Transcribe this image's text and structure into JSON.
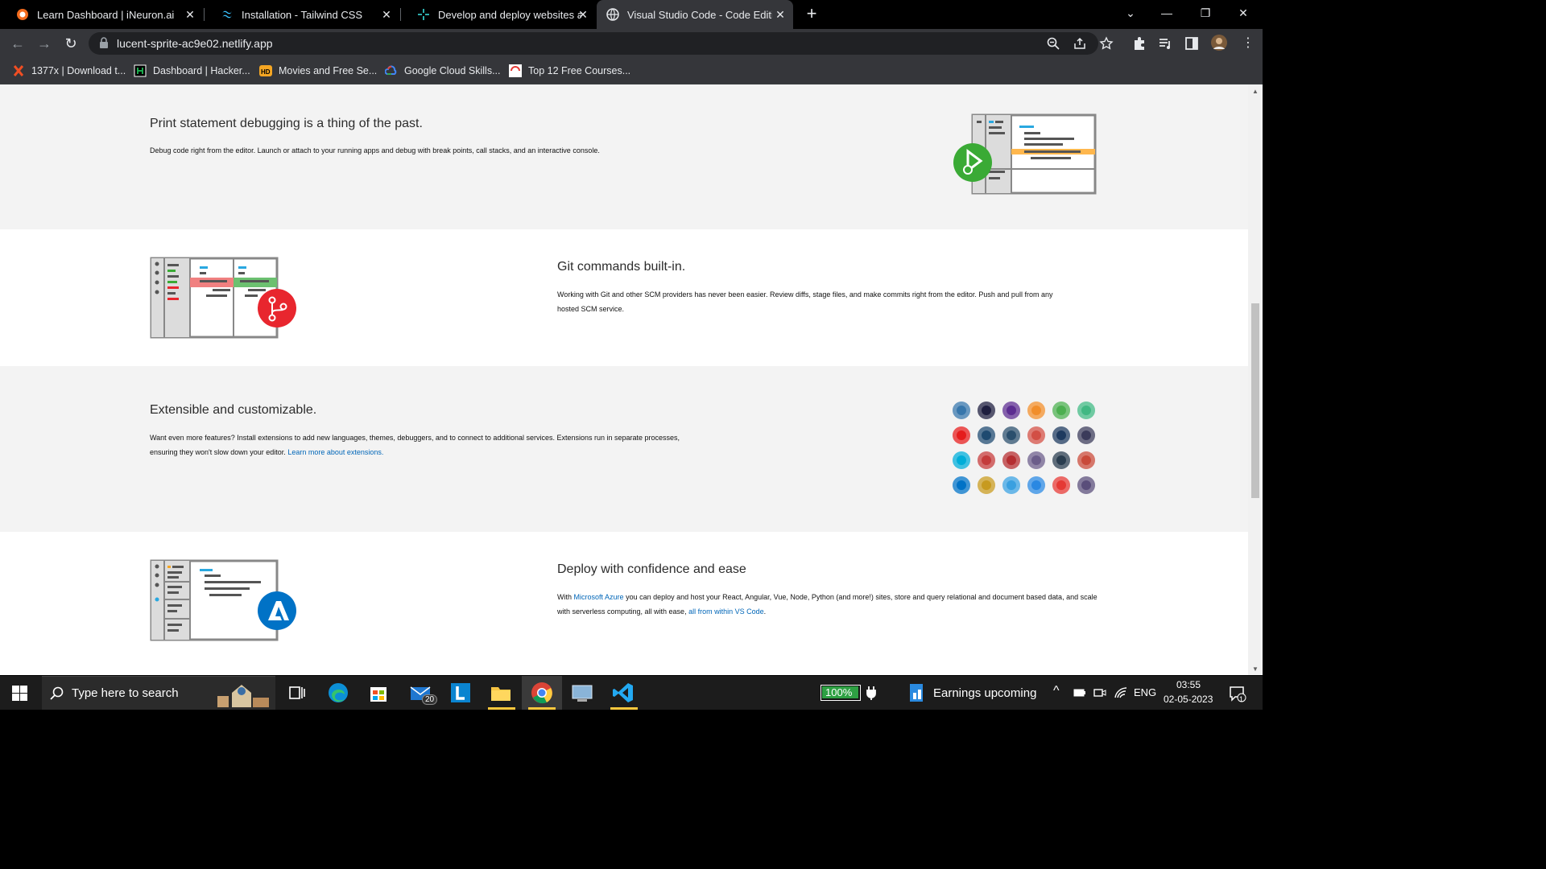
{
  "tabs": [
    {
      "title": "Learn Dashboard | iNeuron.ai",
      "icon": "ineuron-icon"
    },
    {
      "title": "Installation - Tailwind CSS",
      "icon": "tailwind-icon"
    },
    {
      "title": "Develop and deploy websites and",
      "icon": "netlify-icon"
    },
    {
      "title": "Visual Studio Code - Code Editing",
      "icon": "globe-icon"
    }
  ],
  "address_bar": {
    "url": "lucent-sprite-ac9e02.netlify.app"
  },
  "bookmarks": [
    {
      "label": "1377x | Download t...",
      "icon": "x-icon"
    },
    {
      "label": "Dashboard | Hacker...",
      "icon": "hackerrank-icon"
    },
    {
      "label": "Movies and Free Se...",
      "icon": "hd-icon"
    },
    {
      "label": "Google Cloud Skills...",
      "icon": "google-cloud-icon"
    },
    {
      "label": "Top 12 Free Courses...",
      "icon": "courses-icon"
    }
  ],
  "sections": {
    "debug": {
      "title": "Print statement debugging is a thing of the past.",
      "body": "Debug code right from the editor. Launch or attach to your running apps and debug with break points, call stacks, and an interactive console."
    },
    "git": {
      "title": "Git commands built-in.",
      "body": "Working with Git and other SCM providers has never been easier. Review diffs, stage files, and make commits right from the editor. Push and pull from any hosted SCM service."
    },
    "extensible": {
      "title": "Extensible and customizable.",
      "body": "Want even more features? Install extensions to add new languages, themes, debuggers, and to connect to additional services. Extensions run in separate processes, ensuring they won't slow down your editor.",
      "link": "Learn more about extensions."
    },
    "deploy": {
      "title": "Deploy with confidence and ease",
      "body_pre": "With",
      "link1": "Microsoft Azure",
      "body_mid": "you can deploy and host your React, Angular, Vue, Node, Python (and more!) sites, store and query relational and document based data, and scale with serverless computing, all with ease,",
      "link2": "all from within VS Code",
      "body_end": "."
    }
  },
  "extension_icons": [
    {
      "name": "python-icon",
      "color": "#3776ab"
    },
    {
      "name": "n-icon",
      "color": "#1e1e3f"
    },
    {
      "name": "cpp-icon",
      "color": "#5c2d91"
    },
    {
      "name": "eslint-icon",
      "color": "#f18e2b"
    },
    {
      "name": "chrome-debug-icon",
      "color": "#4caf50"
    },
    {
      "name": "vue-icon",
      "color": "#41b883"
    },
    {
      "name": "java-icon",
      "color": "#e51d1d"
    },
    {
      "name": "vscode-icon",
      "color": "#1f4a70"
    },
    {
      "name": "docker-icon",
      "color": "#2b4f6d"
    },
    {
      "name": "m-icon",
      "color": "#d24f45"
    },
    {
      "name": "ts-lint-icon",
      "color": "#1e3a5f"
    },
    {
      "name": "graphql-icon",
      "color": "#3b3b5a"
    },
    {
      "name": "go-icon",
      "color": "#00add8"
    },
    {
      "name": "todo-icon",
      "color": "#c43b3b"
    },
    {
      "name": "angular-icon",
      "color": "#b52e31"
    },
    {
      "name": "theme-icon",
      "color": "#6b5d8a"
    },
    {
      "name": "pyright-icon",
      "color": "#2a3d4f"
    },
    {
      "name": "preview-icon",
      "color": "#c94a3a"
    },
    {
      "name": "azure-storage-icon",
      "color": "#0072c6"
    },
    {
      "name": "json-icon",
      "color": "#c79a1f"
    },
    {
      "name": "diamond-icon",
      "color": "#3aa0e0"
    },
    {
      "name": "powershell-icon",
      "color": "#2a88e2"
    },
    {
      "name": "pdf-icon",
      "color": "#e53935"
    },
    {
      "name": "bulb-icon",
      "color": "#5a4e7a"
    }
  ],
  "taskbar": {
    "search_placeholder": "Type here to search",
    "mail_badge": "20",
    "battery": "100%",
    "news": "Earnings upcoming",
    "lang": "ENG",
    "time": "03:55",
    "date": "02-05-2023",
    "notif_count": "1"
  },
  "colors": {
    "link": "#0066b8",
    "debug_badge": "#3aaa35",
    "git_badge": "#e8262e",
    "azure_badge": "#0072c6"
  }
}
